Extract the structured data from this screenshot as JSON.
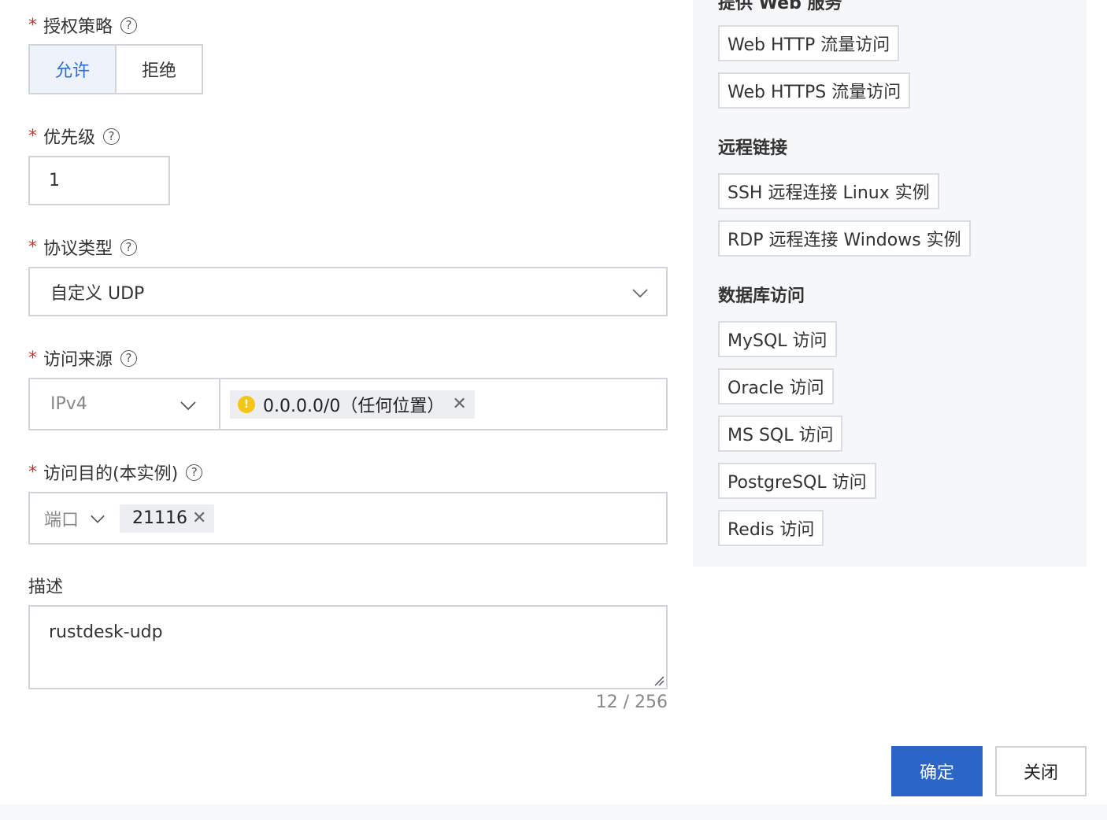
{
  "form": {
    "policy": {
      "label": "授权策略",
      "allow": "允许",
      "deny": "拒绝"
    },
    "priority": {
      "label": "优先级",
      "value": "1"
    },
    "protocol": {
      "label": "协议类型",
      "value": "自定义 UDP"
    },
    "source": {
      "label": "访问来源",
      "ip_version": "IPv4",
      "tag": "0.0.0.0/0（任何位置）"
    },
    "destination": {
      "label": "访问目的(本实例)",
      "type": "端口",
      "tag": "21116"
    },
    "description": {
      "label": "描述",
      "value": "rustdesk-udp",
      "counter": "12 / 256"
    }
  },
  "templates": {
    "web_title_partial": "提供 Web 服务",
    "web": [
      "Web HTTP 流量访问",
      "Web HTTPS 流量访问"
    ],
    "remote_title": "远程链接",
    "remote": [
      "SSH 远程连接 Linux 实例",
      "RDP 远程连接 Windows 实例"
    ],
    "db_title": "数据库访问",
    "db": [
      "MySQL 访问",
      "Oracle 访问",
      "MS SQL 访问",
      "PostgreSQL 访问",
      "Redis 访问"
    ]
  },
  "footer": {
    "confirm": "确定",
    "close": "关闭"
  },
  "colors": {
    "primary": "#2a65c7",
    "required": "#d93026",
    "warning": "#f5c518"
  }
}
